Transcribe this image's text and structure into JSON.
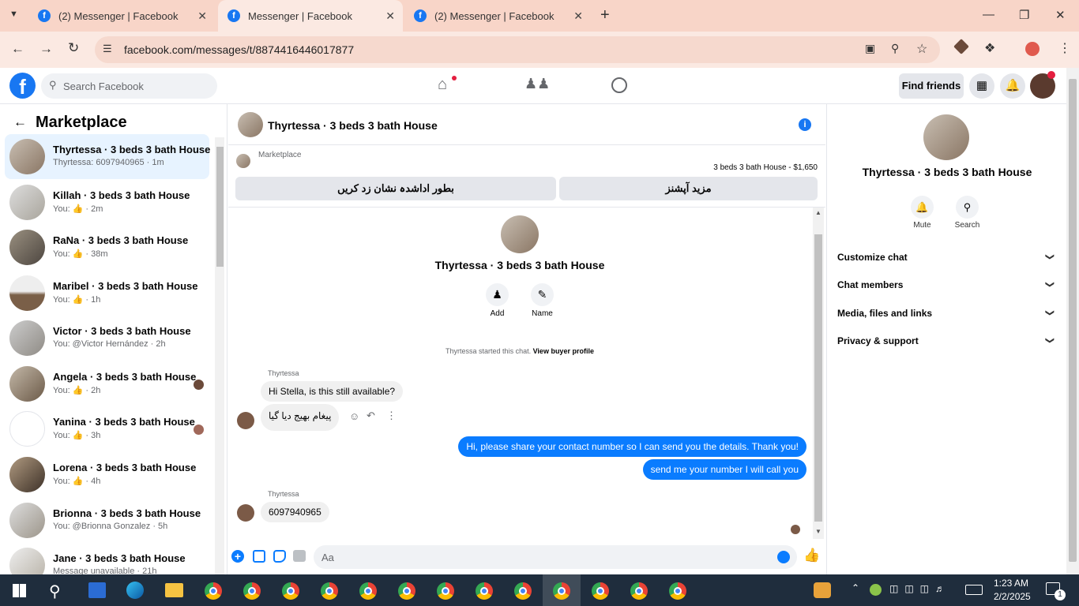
{
  "browser": {
    "tabs": [
      {
        "title": "(2) Messenger | Facebook",
        "active": false
      },
      {
        "title": "Messenger | Facebook",
        "active": true
      },
      {
        "title": "(2) Messenger | Facebook",
        "active": false
      }
    ],
    "new_tab": "+",
    "url": "facebook.com/messages/t/8874416446017877"
  },
  "fb_header": {
    "logo": "f",
    "search_placeholder": "Search Facebook",
    "find_friends": "Find friends"
  },
  "sidebar": {
    "title": "Marketplace",
    "conversations": [
      {
        "name": "Thyrtessa · 3 beds 3 bath House",
        "preview": "Thyrtessa: 6097940965 · 1m",
        "selected": true
      },
      {
        "name": "Killah · 3 beds 3 bath House",
        "preview": "You: 👍 · 2m"
      },
      {
        "name": "RaNa · 3 beds 3 bath House",
        "preview": "You: 👍 · 38m"
      },
      {
        "name": "Maribel · 3 beds 3 bath House",
        "preview": "You: 👍 · 1h"
      },
      {
        "name": "Victor · 3 beds 3 bath House",
        "preview": "You: @Victor Hernández · 2h"
      },
      {
        "name": "Angela · 3 beds 3 bath House",
        "preview": "You: 👍 · 2h"
      },
      {
        "name": "Yanina · 3 beds 3 bath House",
        "preview": "You: 👍 · 3h"
      },
      {
        "name": "Lorena · 3 beds 3 bath House",
        "preview": "You: 👍 · 4h"
      },
      {
        "name": "Brionna · 3 beds 3 bath House",
        "preview": "You: @Brionna Gonzalez · 5h"
      },
      {
        "name": "Jane · 3 beds 3 bath House",
        "preview": "Message unavailable · 21h"
      }
    ]
  },
  "chat": {
    "title": "Thyrtessa · 3 beds 3 bath House",
    "listing_source": "Marketplace",
    "listing_price": "3 beds 3 bath House - $1,650",
    "btn_mark_unread": "بطور اداشدہ نشان زد کریں",
    "btn_more_options": "مزید آپشنز",
    "profile_name": "Thyrtessa · 3 beds 3 bath House",
    "add_label": "Add",
    "name_label": "Name",
    "started_text": "Thyrtessa started this chat.",
    "view_profile": "View buyer profile",
    "messages": [
      {
        "sender": "Thyrtessa",
        "text": "Hi Stella, is this still available?"
      },
      {
        "text": "پیغام بھیج دیا گیا"
      },
      {
        "text": "Hi, please share your contact number so I can send you the details. Thank you!"
      },
      {
        "text": "send me your number I will call you"
      },
      {
        "sender": "Thyrtessa",
        "text": "6097940965"
      }
    ],
    "composer_placeholder": "Aa"
  },
  "details": {
    "name": "Thyrtessa · 3 beds 3 bath House",
    "mute": "Mute",
    "search": "Search",
    "sections": [
      "Customize chat",
      "Chat members",
      "Media, files and links",
      "Privacy & support"
    ]
  },
  "taskbar": {
    "time": "1:23 AM",
    "date": "2/2/2025",
    "notification_count": "1"
  },
  "colors": {
    "fb_blue": "#1877f2",
    "bubble_out": "#0a7cff",
    "tab_strip": "#f8d5c8"
  }
}
